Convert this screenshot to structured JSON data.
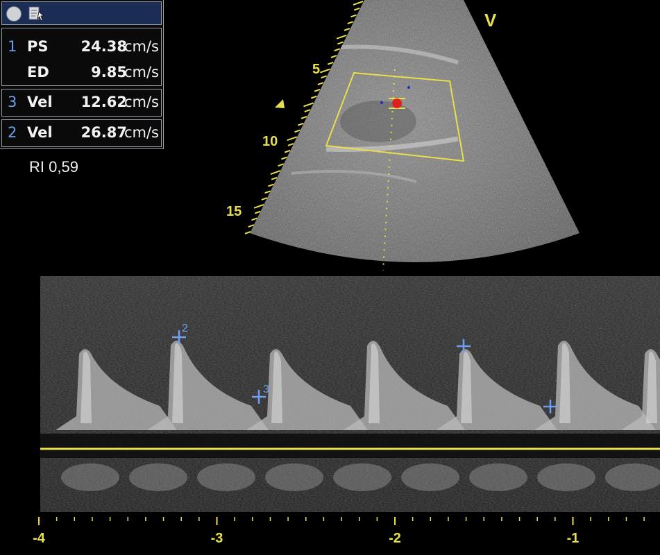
{
  "panel": {
    "m1_index": "1",
    "m1_ps_label": "PS",
    "m1_ps_value": "24.38",
    "m1_ps_unit": "cm/s",
    "m1_ed_label": "ED",
    "m1_ed_value": "9.85",
    "m1_ed_unit": "cm/s",
    "m3_index": "3",
    "m3_label": "Vel",
    "m3_value": "12.62",
    "m3_unit": "cm/s",
    "m2_index": "2",
    "m2_label": "Vel",
    "m2_value": "26.87",
    "m2_unit": "cm/s"
  },
  "ri_text": "RI 0,59",
  "bmode": {
    "orientation_marker": "V",
    "depth_labels": [
      "5",
      "10",
      "15"
    ]
  },
  "doppler": {
    "cursor_labels": [
      "2",
      "3"
    ],
    "time_labels": [
      "-4",
      "-3",
      "-2",
      "-1"
    ]
  },
  "colors": {
    "scale_yellow": "#e8e04a",
    "cursor_blue": "#6f9ff0",
    "panel_header": "#1b2c55",
    "doppler_red": "#e0201e"
  }
}
